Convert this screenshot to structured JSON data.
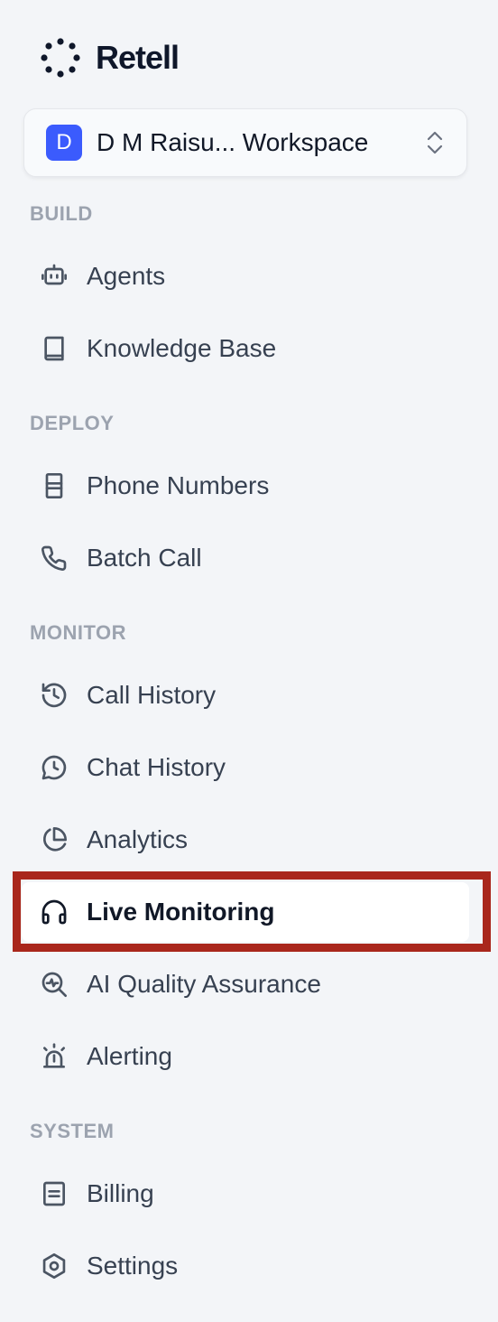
{
  "brand": {
    "name": "Retell",
    "logo_icon": "dotted-ring-logo-icon"
  },
  "workspace": {
    "avatar_letter": "D",
    "name": "D M Raisu... Workspace",
    "switch_icon": "chevron-up-down-icon",
    "avatar_color": "#3b5bfd"
  },
  "sections": {
    "build": "BUILD",
    "deploy": "DEPLOY",
    "monitor": "MONITOR",
    "system": "SYSTEM"
  },
  "nav": {
    "agents": {
      "label": "Agents",
      "icon": "robot-icon"
    },
    "knowledge_base": {
      "label": "Knowledge Base",
      "icon": "book-icon"
    },
    "phone_numbers": {
      "label": "Phone Numbers",
      "icon": "sim-card-icon"
    },
    "batch_call": {
      "label": "Batch Call",
      "icon": "phone-icon"
    },
    "call_history": {
      "label": "Call History",
      "icon": "history-icon"
    },
    "chat_history": {
      "label": "Chat History",
      "icon": "chat-clock-icon"
    },
    "analytics": {
      "label": "Analytics",
      "icon": "pie-chart-icon"
    },
    "live_monitoring": {
      "label": "Live Monitoring",
      "icon": "headphones-icon",
      "active": true
    },
    "ai_qa": {
      "label": "AI Quality Assurance",
      "icon": "search-pulse-icon"
    },
    "alerting": {
      "label": "Alerting",
      "icon": "alarm-siren-icon"
    },
    "billing": {
      "label": "Billing",
      "icon": "receipt-icon"
    },
    "settings": {
      "label": "Settings",
      "icon": "hexagon-gear-icon"
    }
  },
  "colors": {
    "background": "#f3f5f8",
    "highlight": "#a9271c",
    "section_label": "#9ca3af"
  }
}
